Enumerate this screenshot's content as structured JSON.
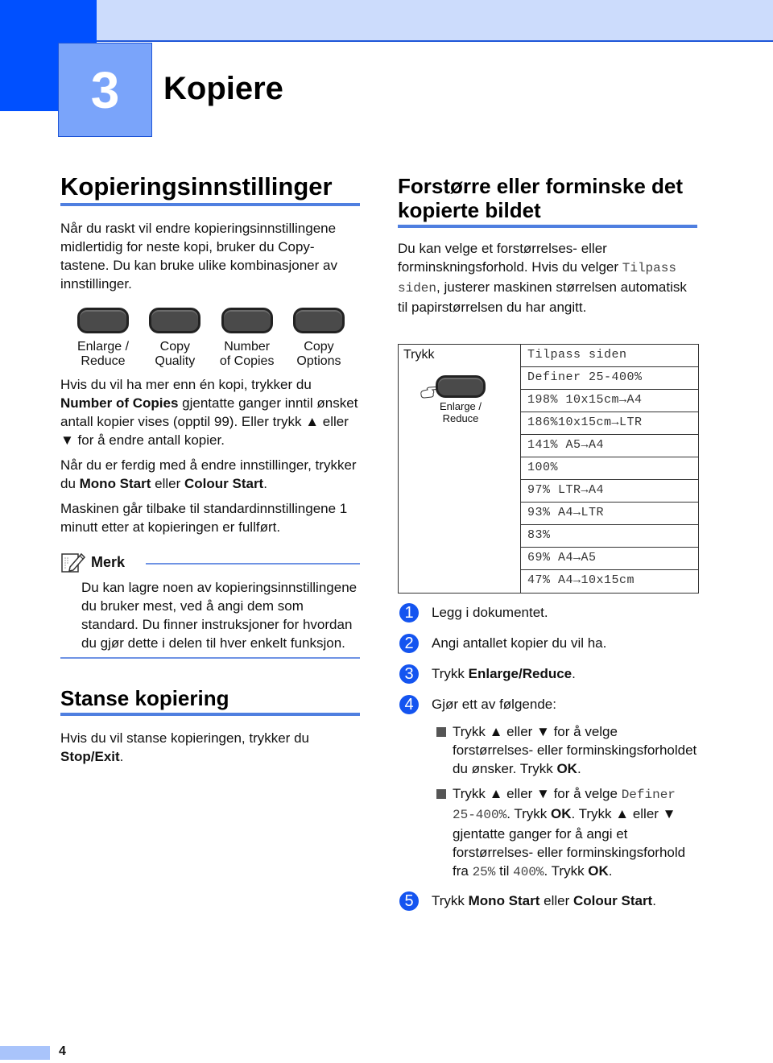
{
  "chapter": {
    "number": "3",
    "title": "Kopiere"
  },
  "left": {
    "section1": {
      "heading": "Kopieringsinnstillinger",
      "intro": "Når du raskt vil endre kopieringsinnstillingene midlertidig for neste kopi, bruker du Copy-tastene. Du kan bruke ulike kombinasjoner av innstillinger.",
      "keys": [
        {
          "line1": "Enlarge /",
          "line2": "Reduce"
        },
        {
          "line1": "Copy",
          "line2": "Quality"
        },
        {
          "line1": "Number",
          "line2": "of Copies"
        },
        {
          "line1": "Copy",
          "line2": "Options"
        }
      ],
      "para1": {
        "a": "Hvis du vil ha mer enn én kopi, trykker du ",
        "b": "Number of Copies",
        "c": " gjentatte ganger inntil ønsket antall kopier vises (opptil 99). Eller trykk ▲ eller ▼ for å endre antall kopier."
      },
      "para2": {
        "a": "Når du er ferdig med å endre innstillinger, trykker du ",
        "b": "Mono Start",
        "c": " eller ",
        "d": "Colour Start",
        "e": "."
      },
      "para3": "Maskinen går tilbake til standardinnstillingene 1 minutt etter at kopieringen er fullført."
    },
    "note": {
      "title": "Merk",
      "body": "Du kan lagre noen av kopieringsinnstillingene du bruker mest, ved å angi dem som standard. Du finner instruksjoner for hvordan du gjør dette i delen til hver enkelt funksjon."
    },
    "section2": {
      "heading": "Stanse kopiering",
      "text_a": "Hvis du vil stanse kopieringen, trykker du ",
      "text_b": "Stop/Exit",
      "text_c": "."
    }
  },
  "right": {
    "heading": "Forstørre eller forminske det kopierte bildet",
    "intro": {
      "a": "Du kan velge et forstørrelses- eller forminskningsforhold. Hvis du velger ",
      "mono": "Tilpass siden",
      "b": ", justerer maskinen størrelsen automatisk til papirstørrelsen du har angitt."
    },
    "table": {
      "press_label": "Trykk",
      "key_line1": "Enlarge /",
      "key_line2": "Reduce",
      "options": [
        "Tilpass siden",
        "Definer 25-400%",
        "198% 10x15cm→A4",
        "186%10x15cm→LTR",
        "141% A5→A4",
        "100%",
        "97% LTR→A4",
        "93% A4→LTR",
        "83%",
        "69% A4→A5",
        "47% A4→10x15cm"
      ]
    },
    "steps": [
      {
        "num": "1",
        "text": "Legg i dokumentet."
      },
      {
        "num": "2",
        "text": "Angi antallet kopier du vil ha."
      },
      {
        "num": "3",
        "a": "Trykk ",
        "b": "Enlarge/Reduce",
        "c": "."
      },
      {
        "num": "4",
        "text": "Gjør ett av følgende:"
      },
      {
        "num": "5",
        "a": "Trykk ",
        "b": "Mono Start",
        "c": " eller ",
        "d": "Colour Start",
        "e": "."
      }
    ],
    "bullets": [
      {
        "a": "Trykk ▲ eller ▼ for å velge forstørrelses- eller forminskingsforholdet du ønsker. Trykk ",
        "b": "OK",
        "c": "."
      },
      {
        "a": "Trykk ▲ eller ▼ for å velge ",
        "mono1": "Definer 25-400%",
        "b": ". Trykk ",
        "ok1": "OK",
        "c": ". Trykk ▲ eller ▼ gjentatte ganger for å angi et forstørrelses- eller forminskingsforhold fra ",
        "mono2": "25%",
        "d": " til ",
        "mono3": "400%",
        "e": ". Trykk ",
        "ok2": "OK",
        "f": "."
      }
    ]
  },
  "footer": {
    "page_number": "4"
  },
  "colors": {
    "banner_dark": "#0050ff",
    "banner_light": "#ccdcfc",
    "chapter_box": "#7aa4fa",
    "rule": "#4f7fe0",
    "step_circle": "#1454f0"
  }
}
